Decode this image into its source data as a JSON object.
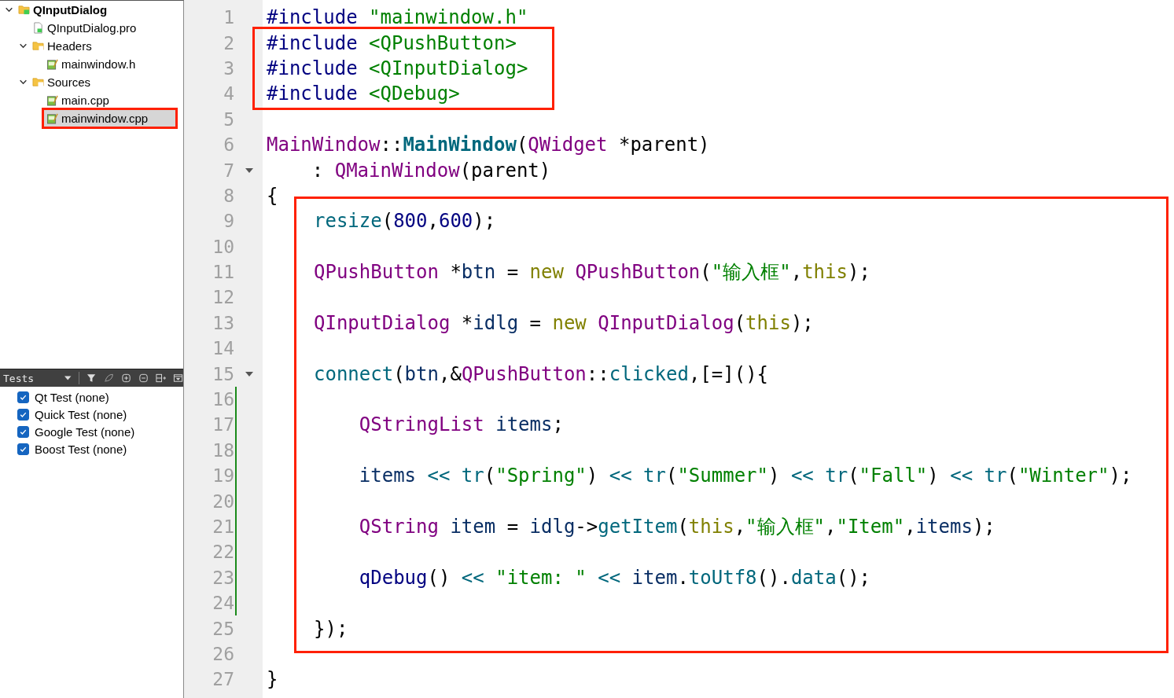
{
  "project_tree": [
    {
      "label": "QInputDialog",
      "kind": "project",
      "expanded": true,
      "selected": false,
      "marked": false,
      "children": [
        {
          "label": "QInputDialog.pro",
          "kind": "project-file",
          "selected": false,
          "marked": false
        },
        {
          "label": "Headers",
          "kind": "header-folder",
          "expanded": true,
          "selected": false,
          "marked": false,
          "children": [
            {
              "label": "mainwindow.h",
              "kind": "source-file",
              "selected": false,
              "marked": false
            }
          ]
        },
        {
          "label": "Sources",
          "kind": "source-folder",
          "expanded": true,
          "selected": false,
          "marked": false,
          "children": [
            {
              "label": "main.cpp",
              "kind": "source-file",
              "selected": false,
              "marked": false
            },
            {
              "label": "mainwindow.cpp",
              "kind": "source-file",
              "selected": true,
              "marked": true
            }
          ]
        }
      ]
    }
  ],
  "tests_panel": {
    "title": "Tests",
    "items": [
      {
        "label": "Qt Test (none)",
        "checked": true
      },
      {
        "label": "Quick Test (none)",
        "checked": true
      },
      {
        "label": "Google Test (none)",
        "checked": true
      },
      {
        "label": "Boost Test (none)",
        "checked": true
      }
    ]
  },
  "editor": {
    "blocks": [
      {
        "kind": "plain",
        "boxed": false,
        "lines": [
          {
            "number": "1",
            "fold": false,
            "modified": false,
            "tokens": [
              {
                "kind": "directive",
                "text": "#include "
              },
              {
                "kind": "string",
                "text": "\"mainwindow.h\""
              }
            ]
          }
        ]
      },
      {
        "kind": "includes",
        "boxed": true,
        "lines": [
          {
            "number": "2",
            "fold": false,
            "modified": false,
            "tokens": [
              {
                "kind": "directive",
                "text": "#include "
              },
              {
                "kind": "string",
                "text": "<QPushButton>"
              }
            ]
          },
          {
            "number": "3",
            "fold": false,
            "modified": false,
            "tokens": [
              {
                "kind": "directive",
                "text": "#include "
              },
              {
                "kind": "string",
                "text": "<QInputDialog>"
              }
            ]
          },
          {
            "number": "4",
            "fold": false,
            "modified": false,
            "tokens": [
              {
                "kind": "directive",
                "text": "#include "
              },
              {
                "kind": "string",
                "text": "<QDebug>"
              }
            ]
          }
        ]
      },
      {
        "kind": "plain",
        "boxed": false,
        "lines": [
          {
            "number": "5",
            "fold": false,
            "modified": false
          },
          {
            "number": "6",
            "fold": false,
            "modified": false,
            "tokens": [
              {
                "kind": "type",
                "text": "MainWindow"
              },
              {
                "kind": "plain",
                "text": "::"
              },
              {
                "kind": "function-def",
                "text": "MainWindow"
              },
              {
                "kind": "plain",
                "text": "("
              },
              {
                "kind": "type",
                "text": "QWidget"
              },
              {
                "kind": "plain",
                "text": " *parent)"
              }
            ]
          },
          {
            "number": "7",
            "fold": true,
            "modified": false,
            "tokens": [
              {
                "kind": "plain",
                "text": "    : "
              },
              {
                "kind": "type",
                "text": "QMainWindow"
              },
              {
                "kind": "plain",
                "text": "(parent)"
              }
            ]
          },
          {
            "number": "8",
            "fold": false,
            "modified": false,
            "tokens": [
              {
                "kind": "plain",
                "text": "{"
              }
            ]
          }
        ]
      },
      {
        "kind": "body",
        "boxed": true,
        "lines": [
          {
            "number": "9",
            "fold": false,
            "modified": false,
            "tokens": [
              {
                "kind": "function",
                "text": "resize"
              },
              {
                "kind": "plain",
                "text": "("
              },
              {
                "kind": "number",
                "text": "800"
              },
              {
                "kind": "plain",
                "text": ","
              },
              {
                "kind": "number",
                "text": "600"
              },
              {
                "kind": "plain",
                "text": ");"
              }
            ]
          },
          {
            "number": "10",
            "fold": false,
            "modified": false
          },
          {
            "number": "11",
            "fold": false,
            "modified": false,
            "tokens": [
              {
                "kind": "type",
                "text": "QPushButton"
              },
              {
                "kind": "plain",
                "text": " *"
              },
              {
                "kind": "variable",
                "text": "btn"
              },
              {
                "kind": "plain",
                "text": " = "
              },
              {
                "kind": "keyword",
                "text": "new "
              },
              {
                "kind": "type",
                "text": "QPushButton"
              },
              {
                "kind": "plain",
                "text": "("
              },
              {
                "kind": "string",
                "text": "\"输入框\""
              },
              {
                "kind": "plain",
                "text": ","
              },
              {
                "kind": "keyword",
                "text": "this"
              },
              {
                "kind": "plain",
                "text": ");"
              }
            ]
          },
          {
            "number": "12",
            "fold": false,
            "modified": false
          },
          {
            "number": "13",
            "fold": false,
            "modified": false,
            "tokens": [
              {
                "kind": "type",
                "text": "QInputDialog"
              },
              {
                "kind": "plain",
                "text": " *"
              },
              {
                "kind": "variable",
                "text": "idlg"
              },
              {
                "kind": "plain",
                "text": " = "
              },
              {
                "kind": "keyword",
                "text": "new "
              },
              {
                "kind": "type",
                "text": "QInputDialog"
              },
              {
                "kind": "plain",
                "text": "("
              },
              {
                "kind": "keyword",
                "text": "this"
              },
              {
                "kind": "plain",
                "text": ");"
              }
            ]
          },
          {
            "number": "14",
            "fold": false,
            "modified": false
          },
          {
            "number": "15",
            "fold": true,
            "modified": false,
            "tokens": [
              {
                "kind": "function",
                "text": "connect"
              },
              {
                "kind": "plain",
                "text": "("
              },
              {
                "kind": "variable",
                "text": "btn"
              },
              {
                "kind": "plain",
                "text": ",&"
              },
              {
                "kind": "type",
                "text": "QPushButton"
              },
              {
                "kind": "plain",
                "text": "::"
              },
              {
                "kind": "function",
                "text": "clicked"
              },
              {
                "kind": "plain",
                "text": ",[=](){"
              }
            ]
          },
          {
            "number": "16",
            "fold": false,
            "modified": true
          },
          {
            "number": "17",
            "fold": false,
            "modified": true,
            "tokens": [
              {
                "kind": "type",
                "text": "    QStringList "
              },
              {
                "kind": "variable",
                "text": "items"
              },
              {
                "kind": "plain",
                "text": ";"
              }
            ]
          },
          {
            "number": "18",
            "fold": false,
            "modified": true
          },
          {
            "number": "19",
            "fold": false,
            "modified": true,
            "tokens": [
              {
                "kind": "variable",
                "text": "    items"
              },
              {
                "kind": "operator",
                "text": " << "
              },
              {
                "kind": "function",
                "text": "tr"
              },
              {
                "kind": "plain",
                "text": "("
              },
              {
                "kind": "string",
                "text": "\"Spring\""
              },
              {
                "kind": "plain",
                "text": ")"
              },
              {
                "kind": "operator",
                "text": " << "
              },
              {
                "kind": "function",
                "text": "tr"
              },
              {
                "kind": "plain",
                "text": "("
              },
              {
                "kind": "string",
                "text": "\"Summer\""
              },
              {
                "kind": "plain",
                "text": ")"
              },
              {
                "kind": "operator",
                "text": " << "
              },
              {
                "kind": "function",
                "text": "tr"
              },
              {
                "kind": "plain",
                "text": "("
              },
              {
                "kind": "string",
                "text": "\"Fall\""
              },
              {
                "kind": "plain",
                "text": ")"
              },
              {
                "kind": "operator",
                "text": " << "
              },
              {
                "kind": "function",
                "text": "tr"
              },
              {
                "kind": "plain",
                "text": "("
              },
              {
                "kind": "string",
                "text": "\"Winter\""
              },
              {
                "kind": "plain",
                "text": ");"
              }
            ]
          },
          {
            "number": "20",
            "fold": false,
            "modified": true
          },
          {
            "number": "21",
            "fold": false,
            "modified": true,
            "tokens": [
              {
                "kind": "type",
                "text": "    QString "
              },
              {
                "kind": "variable",
                "text": "item"
              },
              {
                "kind": "plain",
                "text": " = "
              },
              {
                "kind": "variable",
                "text": "idlg"
              },
              {
                "kind": "plain",
                "text": "->"
              },
              {
                "kind": "function",
                "text": "getItem"
              },
              {
                "kind": "plain",
                "text": "("
              },
              {
                "kind": "keyword",
                "text": "this"
              },
              {
                "kind": "plain",
                "text": ","
              },
              {
                "kind": "string",
                "text": "\"输入框\""
              },
              {
                "kind": "plain",
                "text": ","
              },
              {
                "kind": "string",
                "text": "\"Item\""
              },
              {
                "kind": "plain",
                "text": ","
              },
              {
                "kind": "variable",
                "text": "items"
              },
              {
                "kind": "plain",
                "text": ");"
              }
            ]
          },
          {
            "number": "22",
            "fold": false,
            "modified": true
          },
          {
            "number": "23",
            "fold": false,
            "modified": true,
            "tokens": [
              {
                "kind": "macro",
                "text": "    qDebug"
              },
              {
                "kind": "plain",
                "text": "()"
              },
              {
                "kind": "operator",
                "text": " << "
              },
              {
                "kind": "string",
                "text": "\"item: \""
              },
              {
                "kind": "operator",
                "text": " << "
              },
              {
                "kind": "variable",
                "text": "item"
              },
              {
                "kind": "plain",
                "text": "."
              },
              {
                "kind": "function",
                "text": "toUtf8"
              },
              {
                "kind": "plain",
                "text": "()."
              },
              {
                "kind": "function",
                "text": "data"
              },
              {
                "kind": "plain",
                "text": "();"
              }
            ]
          },
          {
            "number": "24",
            "fold": false,
            "modified": true
          },
          {
            "number": "25",
            "fold": false,
            "modified": false,
            "tokens": [
              {
                "kind": "plain",
                "text": "});"
              }
            ]
          }
        ]
      },
      {
        "kind": "plain",
        "boxed": false,
        "lines": [
          {
            "number": "26",
            "fold": false,
            "modified": false
          },
          {
            "number": "27",
            "fold": false,
            "modified": false,
            "tokens": [
              {
                "kind": "plain",
                "text": "}"
              }
            ]
          }
        ]
      }
    ]
  }
}
